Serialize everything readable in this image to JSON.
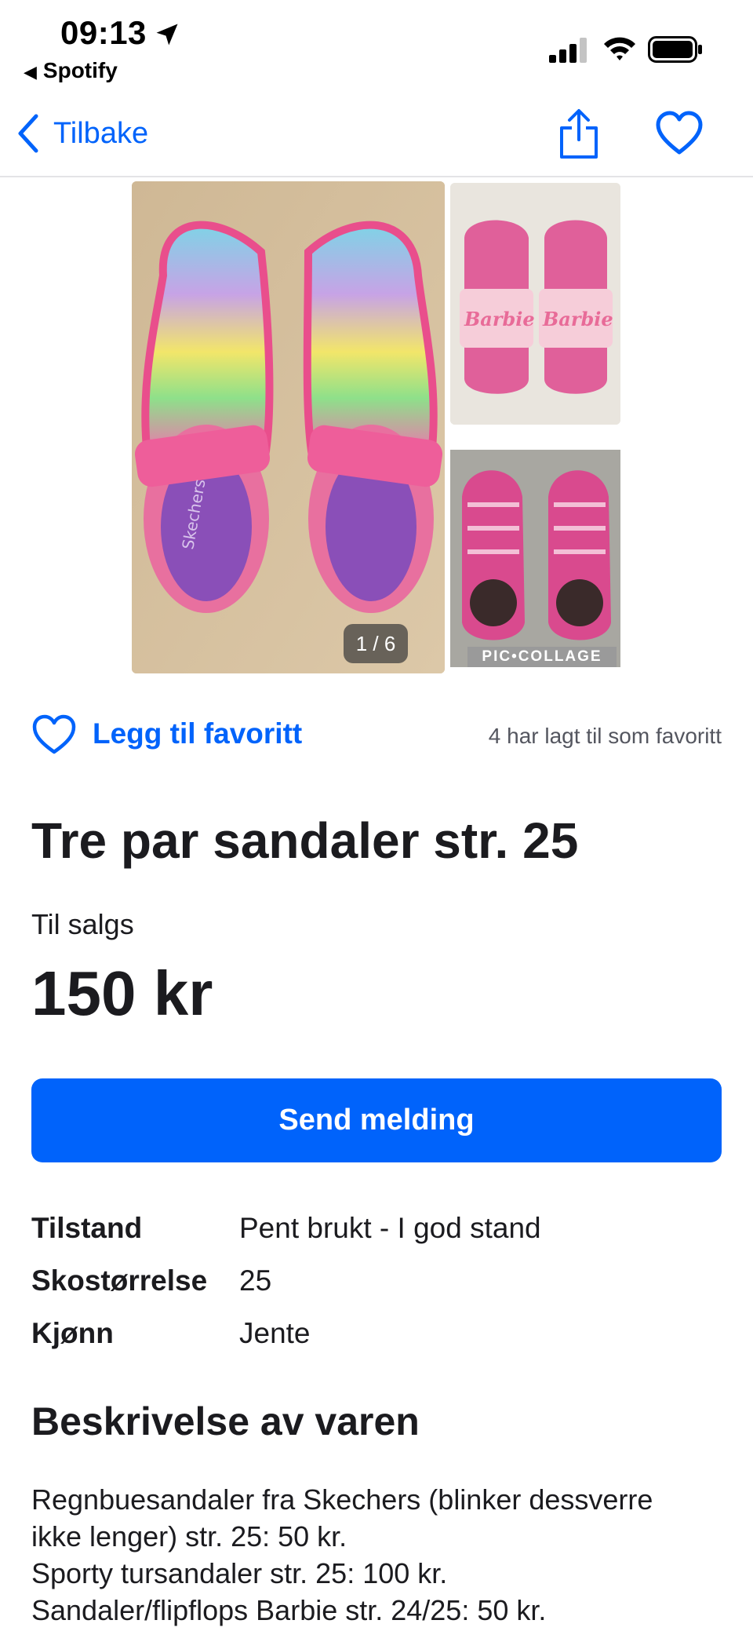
{
  "status_bar": {
    "time": "09:13",
    "back_app": "Spotify"
  },
  "nav": {
    "back_label": "Tilbake",
    "accent_color": "#0063fb"
  },
  "gallery": {
    "counter": "1 / 6",
    "collage_label": "PIC•COLLAGE",
    "main_image_text": "Skechers",
    "barbie_text_left": "Barbie",
    "barbie_text_right": "Barbie"
  },
  "favorite": {
    "label": "Legg til favoritt",
    "count_text": "4 har lagt til som favoritt"
  },
  "listing": {
    "title": "Tre par sandaler str. 25",
    "status": "Til salgs",
    "price": "150 kr",
    "send_button": "Send melding"
  },
  "attributes": [
    {
      "key": "Tilstand",
      "value": "Pent brukt - I god stand"
    },
    {
      "key": "Skostørrelse",
      "value": "25"
    },
    {
      "key": "Kjønn",
      "value": "Jente"
    }
  ],
  "description": {
    "heading": "Beskrivelse av varen",
    "lines": [
      "Regnbuesandaler fra Skechers (blinker dessverre",
      "ikke lenger) str. 25: 50 kr.",
      "Sporty tursandaler str. 25: 100 kr.",
      "Sandaler/flipflops Barbie str. 24/25: 50 kr."
    ]
  }
}
